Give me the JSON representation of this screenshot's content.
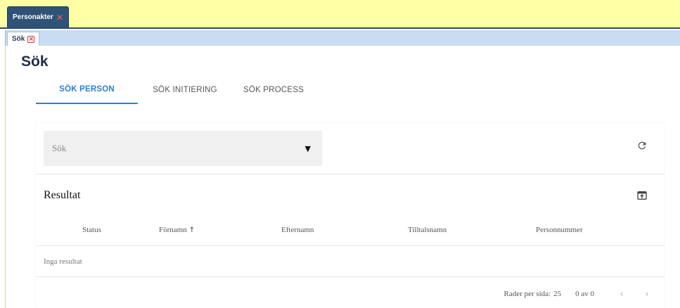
{
  "top_tab": {
    "label": "Personakter",
    "close_glyph": "✕"
  },
  "sub_tab": {
    "label": "Sök",
    "close_glyph": "×"
  },
  "page": {
    "title": "Sök"
  },
  "tabs": [
    {
      "label": "SÖK PERSON",
      "active": true
    },
    {
      "label": "SÖK INITIERING",
      "active": false
    },
    {
      "label": "SÖK PROCESS",
      "active": false
    }
  ],
  "search": {
    "placeholder": "Sök",
    "dropdown_glyph": "▼"
  },
  "results": {
    "title": "Resultat",
    "columns": [
      "Status",
      "Förnamn",
      "Efternamn",
      "Tilltalsnamn",
      "Personnummer"
    ],
    "sort_glyph": "↑",
    "empty_text": "Inga resultat"
  },
  "pagination": {
    "rows_label": "Rader per sida:",
    "rows_per_page": "25",
    "range": "0 av 0",
    "prev_glyph": "‹",
    "next_glyph": "›"
  },
  "colors": {
    "top_strip": "#ffffa6",
    "tab_dark": "#2f5378",
    "sub_strip": "#c8dcf2",
    "accent": "#2b7fd6"
  },
  "icons": [
    "close-icon",
    "refresh-icon",
    "export-icon",
    "dropdown-arrow-icon",
    "sort-ascending-icon",
    "chevron-left-icon",
    "chevron-right-icon"
  ]
}
